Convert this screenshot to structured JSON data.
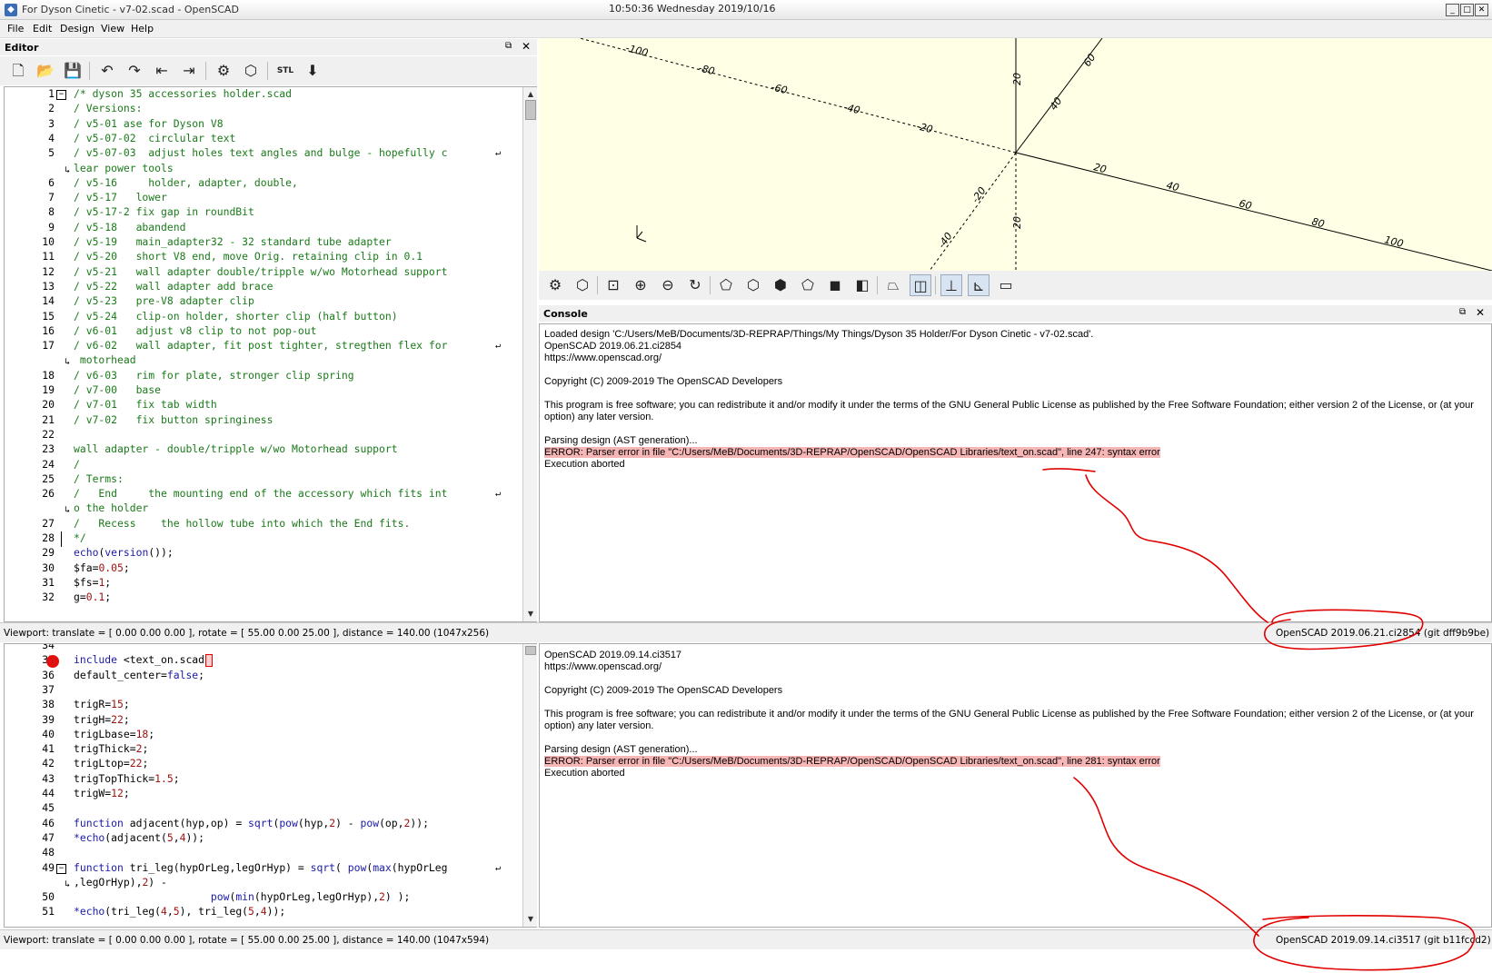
{
  "window": {
    "title": "For Dyson Cinetic - v7-02.scad - OpenSCAD",
    "clock": "10:50:36 Wednesday 2019/10/16"
  },
  "menu": [
    "File",
    "Edit",
    "Design",
    "View",
    "Help"
  ],
  "editor_panel": {
    "title": "Editor"
  },
  "console_panel": {
    "title": "Console"
  },
  "icons": {
    "editor_toolbar": [
      "new-file-icon",
      "open-file-icon",
      "save-icon",
      "undo-icon",
      "redo-icon",
      "unindent-icon",
      "indent-icon",
      "preview-icon",
      "render-icon",
      "export-stl-icon",
      "send-to-printer-icon"
    ],
    "view_toolbar": [
      "preview-icon",
      "render-icon",
      "view-all-icon",
      "zoom-in-icon",
      "zoom-out-icon",
      "reset-view-icon",
      "view-right-icon",
      "view-top-icon",
      "view-bottom-icon",
      "view-left-icon",
      "view-front-icon",
      "view-back-icon",
      "perspective-icon",
      "orthogonal-icon",
      "show-axes-icon",
      "show-scale-markers-icon",
      "show-edges-icon"
    ]
  },
  "editor_top_lines": [
    {
      "n": "1",
      "t": "/* dyson 35 accessories holder.scad",
      "c": "cm",
      "fold": "box"
    },
    {
      "n": "2",
      "t": "/ Versions:",
      "c": "cm"
    },
    {
      "n": "3",
      "t": "/ v5-01 ase for Dyson V8",
      "c": "cm"
    },
    {
      "n": "4",
      "t": "/ v5-07-02  circlular text",
      "c": "cm"
    },
    {
      "n": "5",
      "t": "/ v5-07-03  adjust holes text angles and bulge - hopefully c",
      "c": "cm",
      "wrap": true
    },
    {
      "n": "",
      "t": "lear power tools",
      "c": "cm"
    },
    {
      "n": "6",
      "t": "/ v5-16     holder, adapter, double,",
      "c": "cm"
    },
    {
      "n": "7",
      "t": "/ v5-17   lower",
      "c": "cm"
    },
    {
      "n": "8",
      "t": "/ v5-17-2 fix gap in roundBit",
      "c": "cm"
    },
    {
      "n": "9",
      "t": "/ v5-18   abandend",
      "c": "cm"
    },
    {
      "n": "10",
      "t": "/ v5-19   main_adapter32 - 32 standard tube adapter",
      "c": "cm"
    },
    {
      "n": "11",
      "t": "/ v5-20   short V8 end, move Orig. retaining clip in 0.1",
      "c": "cm"
    },
    {
      "n": "12",
      "t": "/ v5-21   wall adapter double/tripple w/wo Motorhead support",
      "c": "cm"
    },
    {
      "n": "13",
      "t": "/ v5-22   wall adapter add brace",
      "c": "cm"
    },
    {
      "n": "14",
      "t": "/ v5-23   pre-V8 adapter clip",
      "c": "cm"
    },
    {
      "n": "15",
      "t": "/ v5-24   clip-on holder, shorter clip (half button)",
      "c": "cm"
    },
    {
      "n": "16",
      "t": "/ v6-01   adjust v8 clip to not pop-out",
      "c": "cm"
    },
    {
      "n": "17",
      "t": "/ v6-02   wall adapter, fit post tighter, stregthen flex for",
      "c": "cm",
      "wrap": true
    },
    {
      "n": "",
      "t": " motorhead",
      "c": "cm"
    },
    {
      "n": "18",
      "t": "/ v6-03   rim for plate, stronger clip spring",
      "c": "cm"
    },
    {
      "n": "19",
      "t": "/ v7-00   base",
      "c": "cm"
    },
    {
      "n": "20",
      "t": "/ v7-01   fix tab width",
      "c": "cm"
    },
    {
      "n": "21",
      "t": "/ v7-02   fix button springiness",
      "c": "cm"
    },
    {
      "n": "22",
      "t": "",
      "c": "cm"
    },
    {
      "n": "23",
      "t": "wall adapter - double/tripple w/wo Motorhead support",
      "c": "cm"
    },
    {
      "n": "24",
      "t": "/",
      "c": "cm"
    },
    {
      "n": "25",
      "t": "/ Terms:",
      "c": "cm"
    },
    {
      "n": "26",
      "t": "/   End     the mounting end of the accessory which fits int",
      "c": "cm",
      "wrap": true
    },
    {
      "n": "",
      "t": "o the holder",
      "c": "cm"
    },
    {
      "n": "27",
      "t": "/   Recess    the hollow tube into which the End fits.",
      "c": "cm"
    },
    {
      "n": "28",
      "t": "*/",
      "c": "cm",
      "fold": "end"
    },
    {
      "n": "29",
      "t": "echo(version());",
      "c": "mixed1"
    },
    {
      "n": "30",
      "t": "$fa=0.05;",
      "c": "mixed2"
    },
    {
      "n": "31",
      "t": "$fs=1;",
      "c": "mixed3"
    },
    {
      "n": "32",
      "t": "g=0.1;",
      "c": "mixed4"
    }
  ],
  "editor_bottom_lines": [
    {
      "n": "34",
      "t": "",
      "c": "bk"
    },
    {
      "n": "35",
      "t": "include <text_on.scad>",
      "c": "inc",
      "bp": true
    },
    {
      "n": "36",
      "t": "default_center=false;",
      "c": "dc"
    },
    {
      "n": "37",
      "t": "",
      "c": "bk"
    },
    {
      "n": "38",
      "t": "trigR=15;",
      "c": "as",
      "num": "15"
    },
    {
      "n": "39",
      "t": "trigH=22;",
      "c": "as",
      "num": "22"
    },
    {
      "n": "40",
      "t": "trigLbase=18;",
      "c": "as",
      "num": "18"
    },
    {
      "n": "41",
      "t": "trigThick=2;",
      "c": "as",
      "num": "2"
    },
    {
      "n": "42",
      "t": "trigLtop=22;",
      "c": "as",
      "num": "22"
    },
    {
      "n": "43",
      "t": "trigTopThick=1.5;",
      "c": "as",
      "num": "1.5"
    },
    {
      "n": "44",
      "t": "trigW=12;",
      "c": "as",
      "num": "12"
    },
    {
      "n": "45",
      "t": "",
      "c": "bk"
    },
    {
      "n": "46",
      "t": "function adjacent(hyp,op) = sqrt(pow(hyp,2) - pow(op,2));",
      "c": "fn1"
    },
    {
      "n": "47",
      "t": "*echo(adjacent(5,4));",
      "c": "fn2"
    },
    {
      "n": "48",
      "t": "",
      "c": "bk"
    },
    {
      "n": "49",
      "t": "function tri_leg(hypOrLeg,legOrHyp) = sqrt( pow(max(hypOrLeg",
      "c": "fn3",
      "fold": "box",
      "wrap": true
    },
    {
      "n": "",
      "t": ",legOrHyp),2) -",
      "c": "fn4"
    },
    {
      "n": "50",
      "t": "                      pow(min(hypOrLeg,legOrHyp),2) );",
      "c": "fn5"
    },
    {
      "n": "51",
      "t": "*echo(tri_leg(4,5), tri_leg(5,4));",
      "c": "fn6"
    }
  ],
  "console_top": {
    "lines": [
      "Loaded design 'C:/Users/MeB/Documents/3D-REPRAP/Things/My Things/Dyson 35 Holder/For Dyson Cinetic - v7-02.scad'.",
      "OpenSCAD 2019.06.21.ci2854",
      "https://www.openscad.org/",
      "",
      "Copyright (C) 2009-2019 The OpenSCAD Developers",
      "",
      "This program is free software; you can redistribute it and/or modify it under the terms of the GNU General Public License as published by the Free Software Foundation; either version 2 of the License, or (at your",
      "option) any later version.",
      "",
      "Parsing design (AST generation)..."
    ],
    "error": "ERROR: Parser error in file \"C:/Users/MeB/Documents/3D-REPRAP/OpenSCAD/OpenSCAD Libraries/text_on.scad\", line 247: syntax error",
    "after": "Execution aborted"
  },
  "console_bottom": {
    "lines": [
      "OpenSCAD 2019.09.14.ci3517",
      "https://www.openscad.org/",
      "",
      "Copyright (C) 2009-2019 The OpenSCAD Developers",
      "",
      "This program is free software; you can redistribute it and/or modify it under the terms of the GNU General Public License as published by the Free Software Foundation; either version 2 of the License, or (at your",
      "option) any later version.",
      "",
      "Parsing design (AST generation)..."
    ],
    "error": "ERROR: Parser error in file \"C:/Users/MeB/Documents/3D-REPRAP/OpenSCAD/OpenSCAD Libraries/text_on.scad\", line 281: syntax error",
    "after": "Execution aborted"
  },
  "status_top": {
    "left": "Viewport: translate = [ 0.00 0.00 0.00 ], rotate = [ 55.00 0.00 25.00 ], distance = 140.00 (1047x256)",
    "right": "OpenSCAD 2019.06.21.ci2854 (git dff9b9be)"
  },
  "status_bottom": {
    "left": "Viewport: translate = [ 0.00 0.00 0.00 ], rotate = [ 55.00 0.00 25.00 ], distance = 140.00 (1047x594)",
    "right": "OpenSCAD 2019.09.14.ci3517 (git b11fccd2)"
  },
  "axis_labels": [
    "-100",
    "-80",
    "-60",
    "-40",
    "-20",
    "20",
    "40",
    "60",
    "80",
    "100",
    "20",
    "40",
    "60",
    "-20",
    "-40",
    "-60",
    "20"
  ],
  "colors": {
    "viewport_bg": "#ffffe5",
    "error_highlight": "#f6b6b6",
    "annotation": "#e00000",
    "comment": "#1a7a1a",
    "keyword": "#1a1aa8",
    "number": "#a01010"
  }
}
